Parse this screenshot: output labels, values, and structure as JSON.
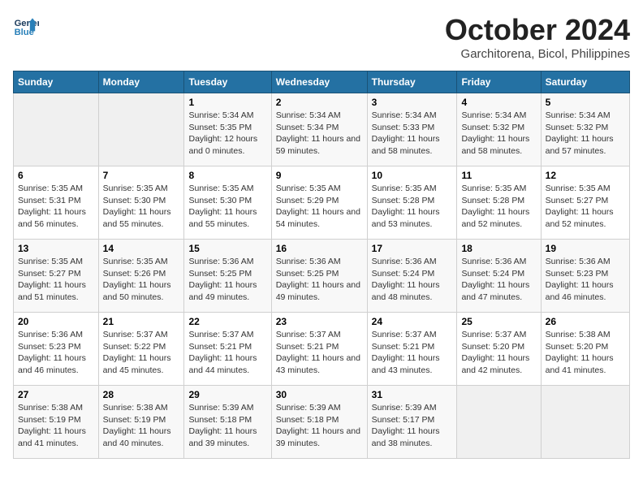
{
  "header": {
    "logo_line1": "General",
    "logo_line2": "Blue",
    "month": "October 2024",
    "location": "Garchitorena, Bicol, Philippines"
  },
  "weekdays": [
    "Sunday",
    "Monday",
    "Tuesday",
    "Wednesday",
    "Thursday",
    "Friday",
    "Saturday"
  ],
  "weeks": [
    [
      {
        "day": "",
        "empty": true
      },
      {
        "day": "",
        "empty": true
      },
      {
        "day": "1",
        "sunrise": "5:34 AM",
        "sunset": "5:35 PM",
        "daylight": "12 hours and 0 minutes."
      },
      {
        "day": "2",
        "sunrise": "5:34 AM",
        "sunset": "5:34 PM",
        "daylight": "11 hours and 59 minutes."
      },
      {
        "day": "3",
        "sunrise": "5:34 AM",
        "sunset": "5:33 PM",
        "daylight": "11 hours and 58 minutes."
      },
      {
        "day": "4",
        "sunrise": "5:34 AM",
        "sunset": "5:32 PM",
        "daylight": "11 hours and 58 minutes."
      },
      {
        "day": "5",
        "sunrise": "5:34 AM",
        "sunset": "5:32 PM",
        "daylight": "11 hours and 57 minutes."
      }
    ],
    [
      {
        "day": "6",
        "sunrise": "5:35 AM",
        "sunset": "5:31 PM",
        "daylight": "11 hours and 56 minutes."
      },
      {
        "day": "7",
        "sunrise": "5:35 AM",
        "sunset": "5:30 PM",
        "daylight": "11 hours and 55 minutes."
      },
      {
        "day": "8",
        "sunrise": "5:35 AM",
        "sunset": "5:30 PM",
        "daylight": "11 hours and 55 minutes."
      },
      {
        "day": "9",
        "sunrise": "5:35 AM",
        "sunset": "5:29 PM",
        "daylight": "11 hours and 54 minutes."
      },
      {
        "day": "10",
        "sunrise": "5:35 AM",
        "sunset": "5:28 PM",
        "daylight": "11 hours and 53 minutes."
      },
      {
        "day": "11",
        "sunrise": "5:35 AM",
        "sunset": "5:28 PM",
        "daylight": "11 hours and 52 minutes."
      },
      {
        "day": "12",
        "sunrise": "5:35 AM",
        "sunset": "5:27 PM",
        "daylight": "11 hours and 52 minutes."
      }
    ],
    [
      {
        "day": "13",
        "sunrise": "5:35 AM",
        "sunset": "5:27 PM",
        "daylight": "11 hours and 51 minutes."
      },
      {
        "day": "14",
        "sunrise": "5:35 AM",
        "sunset": "5:26 PM",
        "daylight": "11 hours and 50 minutes."
      },
      {
        "day": "15",
        "sunrise": "5:36 AM",
        "sunset": "5:25 PM",
        "daylight": "11 hours and 49 minutes."
      },
      {
        "day": "16",
        "sunrise": "5:36 AM",
        "sunset": "5:25 PM",
        "daylight": "11 hours and 49 minutes."
      },
      {
        "day": "17",
        "sunrise": "5:36 AM",
        "sunset": "5:24 PM",
        "daylight": "11 hours and 48 minutes."
      },
      {
        "day": "18",
        "sunrise": "5:36 AM",
        "sunset": "5:24 PM",
        "daylight": "11 hours and 47 minutes."
      },
      {
        "day": "19",
        "sunrise": "5:36 AM",
        "sunset": "5:23 PM",
        "daylight": "11 hours and 46 minutes."
      }
    ],
    [
      {
        "day": "20",
        "sunrise": "5:36 AM",
        "sunset": "5:23 PM",
        "daylight": "11 hours and 46 minutes."
      },
      {
        "day": "21",
        "sunrise": "5:37 AM",
        "sunset": "5:22 PM",
        "daylight": "11 hours and 45 minutes."
      },
      {
        "day": "22",
        "sunrise": "5:37 AM",
        "sunset": "5:21 PM",
        "daylight": "11 hours and 44 minutes."
      },
      {
        "day": "23",
        "sunrise": "5:37 AM",
        "sunset": "5:21 PM",
        "daylight": "11 hours and 43 minutes."
      },
      {
        "day": "24",
        "sunrise": "5:37 AM",
        "sunset": "5:21 PM",
        "daylight": "11 hours and 43 minutes."
      },
      {
        "day": "25",
        "sunrise": "5:37 AM",
        "sunset": "5:20 PM",
        "daylight": "11 hours and 42 minutes."
      },
      {
        "day": "26",
        "sunrise": "5:38 AM",
        "sunset": "5:20 PM",
        "daylight": "11 hours and 41 minutes."
      }
    ],
    [
      {
        "day": "27",
        "sunrise": "5:38 AM",
        "sunset": "5:19 PM",
        "daylight": "11 hours and 41 minutes."
      },
      {
        "day": "28",
        "sunrise": "5:38 AM",
        "sunset": "5:19 PM",
        "daylight": "11 hours and 40 minutes."
      },
      {
        "day": "29",
        "sunrise": "5:39 AM",
        "sunset": "5:18 PM",
        "daylight": "11 hours and 39 minutes."
      },
      {
        "day": "30",
        "sunrise": "5:39 AM",
        "sunset": "5:18 PM",
        "daylight": "11 hours and 39 minutes."
      },
      {
        "day": "31",
        "sunrise": "5:39 AM",
        "sunset": "5:17 PM",
        "daylight": "11 hours and 38 minutes."
      },
      {
        "day": "",
        "empty": true
      },
      {
        "day": "",
        "empty": true
      }
    ]
  ],
  "labels": {
    "sunrise_prefix": "Sunrise: ",
    "sunset_prefix": "Sunset: ",
    "daylight_prefix": "Daylight: "
  }
}
